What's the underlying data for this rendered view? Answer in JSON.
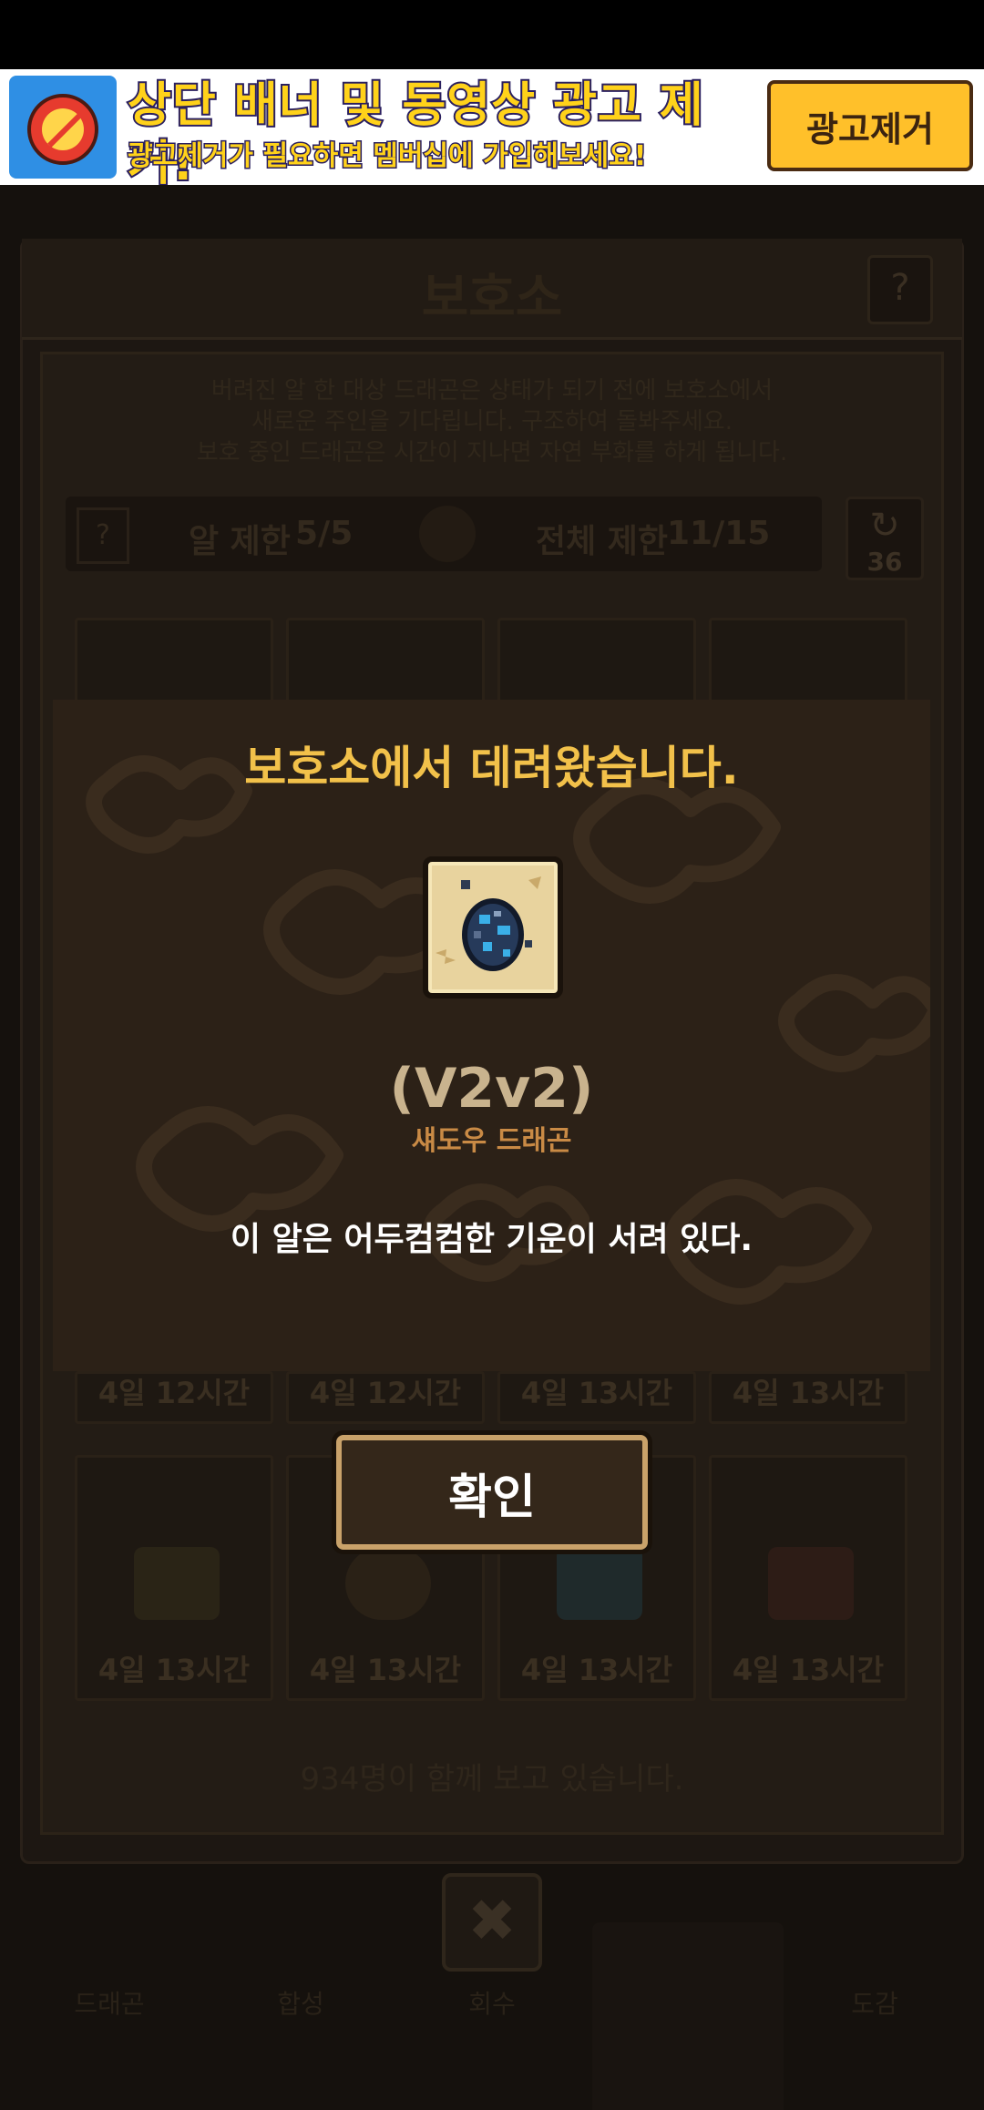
{
  "ad": {
    "title": "상단 배너 및 동영상 광고 제거!",
    "subtitle": "광고제거가 필요하면 멤버십에 가입해보세요!",
    "button": "광고제거",
    "icon": "no-ads-timer-icon"
  },
  "shelter": {
    "title": "보호소",
    "help": "?",
    "description": [
      "버려진 알 한 대상 드래곤은 상태가 되기 전에 보호소에서",
      "새로운 주인을 기다립니다. 구조하여 돌봐주세요.",
      "보호 중인 드래곤은 시간이 지나면 자연 부화를 하게 됩니다."
    ],
    "egg_limit_label": "알 제한",
    "egg_limit_value": "5/5",
    "total_limit_label": "전체 제한",
    "total_limit_value": "11/15",
    "refresh_count": "36",
    "slots_row2": [
      "4일 12시간",
      "4일 12시간",
      "4일 13시간",
      "4일 13시간"
    ],
    "slots_row3": [
      "4일 13시간",
      "4일 13시간",
      "4일 13시간",
      "4일 13시간"
    ],
    "watchers": "934명이 함께 보고 있습니다."
  },
  "bottom_nav": [
    "드래곤",
    "합성",
    "회수",
    "",
    "도감"
  ],
  "modal": {
    "title": "보호소에서 데려왔습니다.",
    "egg_name": "(V2v2)",
    "egg_type": "섀도우 드래곤",
    "egg_description": "이 알은 어두컴컴한 기운이 서려 있다.",
    "egg_icon": "shadow-dragon-egg-icon",
    "confirm": "확인"
  },
  "colors": {
    "modal_bg": "#2c2117",
    "title_gold": "#f2c14a",
    "type_orange": "#c98a45",
    "ad_yellow": "#ffd21a"
  }
}
